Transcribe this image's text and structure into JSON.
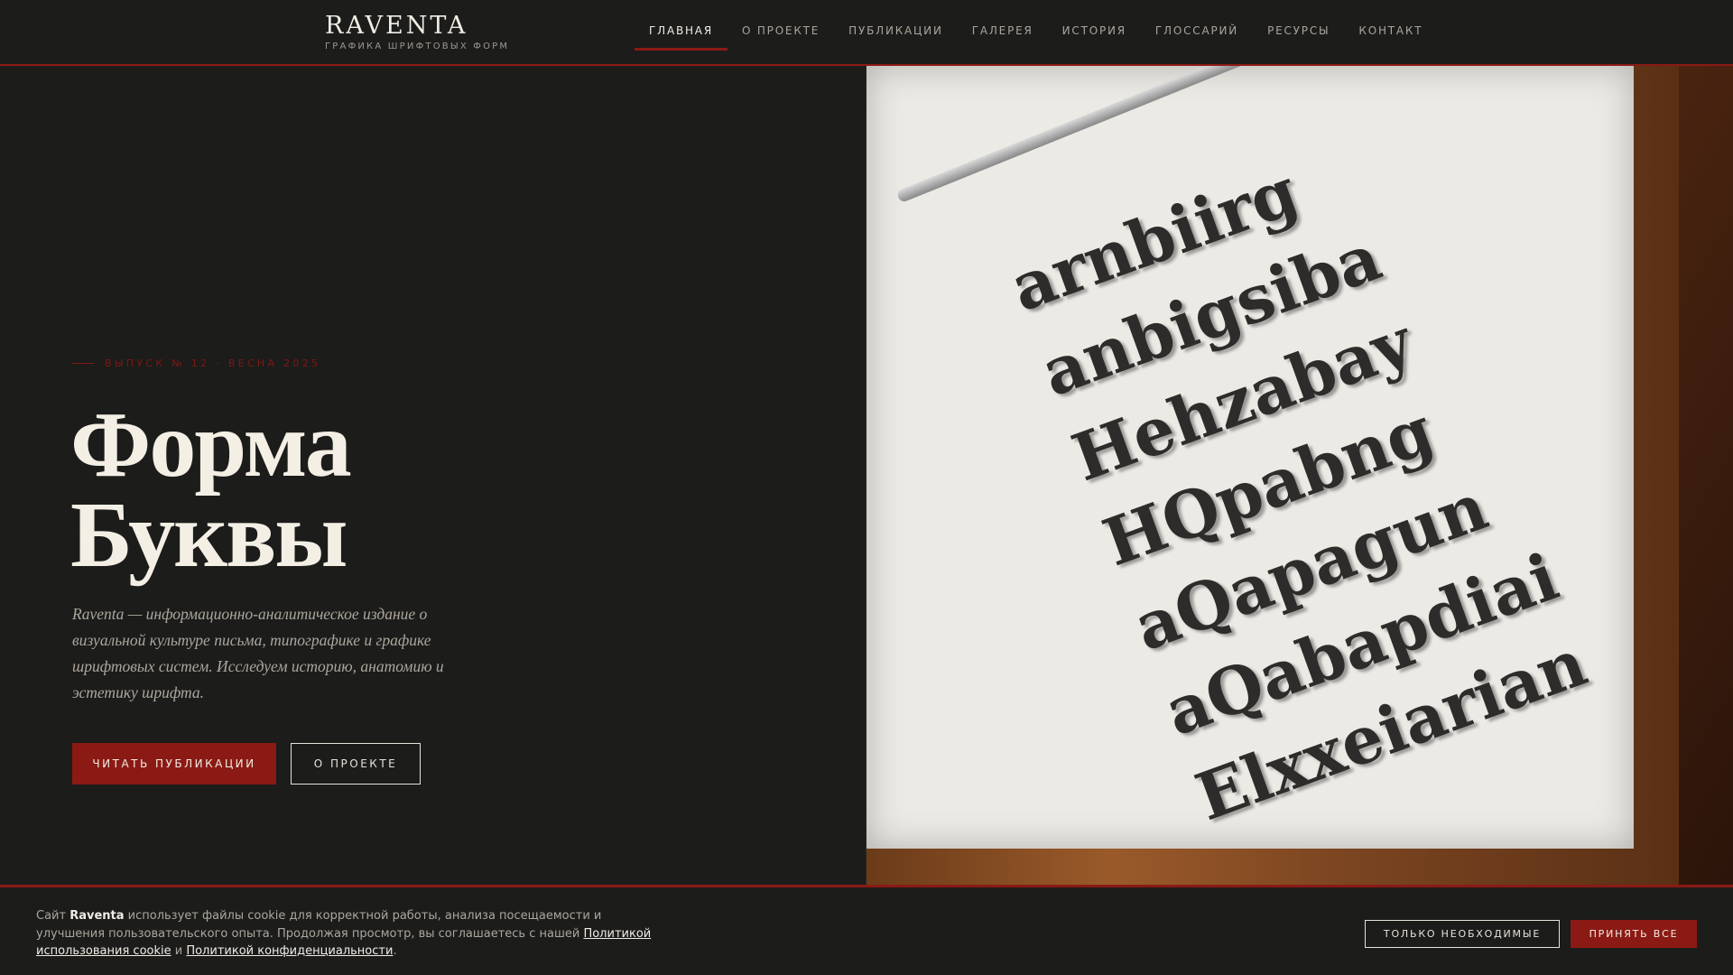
{
  "header": {
    "logo_title": "RAVENTA",
    "logo_subtitle": "ГРАФИКА ШРИФТОВЫХ ФОРМ",
    "nav": [
      "ГЛАВНАЯ",
      "О ПРОЕКТЕ",
      "ПУБЛИКАЦИИ",
      "ГАЛЕРЕЯ",
      "ИСТОРИЯ",
      "ГЛОССАРИЙ",
      "РЕСУРСЫ",
      "КОНТАКТ"
    ],
    "active_nav": "ГЛАВНАЯ"
  },
  "hero": {
    "eyebrow": "ВЫПУСК № 12 · ВЕСНА 2025",
    "title_line1": "Форма",
    "title_line2": "Буквы",
    "lead": "Raventa — информационно-аналитическое издание о визуальной культуре письма, типографике и графике шрифтовых систем. Исследуем историю, анатомию и эстетику шрифта.",
    "primary_button": "ЧИТАТЬ ПУБЛИКАЦИИ",
    "secondary_button": "О ПРОЕКТЕ"
  },
  "photo": {
    "letters": [
      "arnbiirg",
      "anbigsiba",
      "Hehzabay",
      "HQpabng",
      "aQapagun",
      "aQabapdiai",
      "Elxxeiarian"
    ]
  },
  "cookie": {
    "text_before": "Сайт ",
    "brand": "Raventa",
    "text_middle": " использует файлы cookie для корректной работы, анализа посещаемости и улучшения пользовательского опыта. Продолжая просмотр, вы соглашаетесь с нашей ",
    "link_cookie": "Политикой использования cookie",
    "text_and": " и ",
    "link_privacy": "Политикой конфиденциальности",
    "text_end": ".",
    "necessary_button": "ТОЛЬКО НЕОБХОДИМЫЕ",
    "accept_button": "ПРИНЯТЬ ВСЕ"
  },
  "colors": {
    "accent": "#8b1a15",
    "background": "#1c1c1b",
    "text_light": "#f1ede4"
  }
}
